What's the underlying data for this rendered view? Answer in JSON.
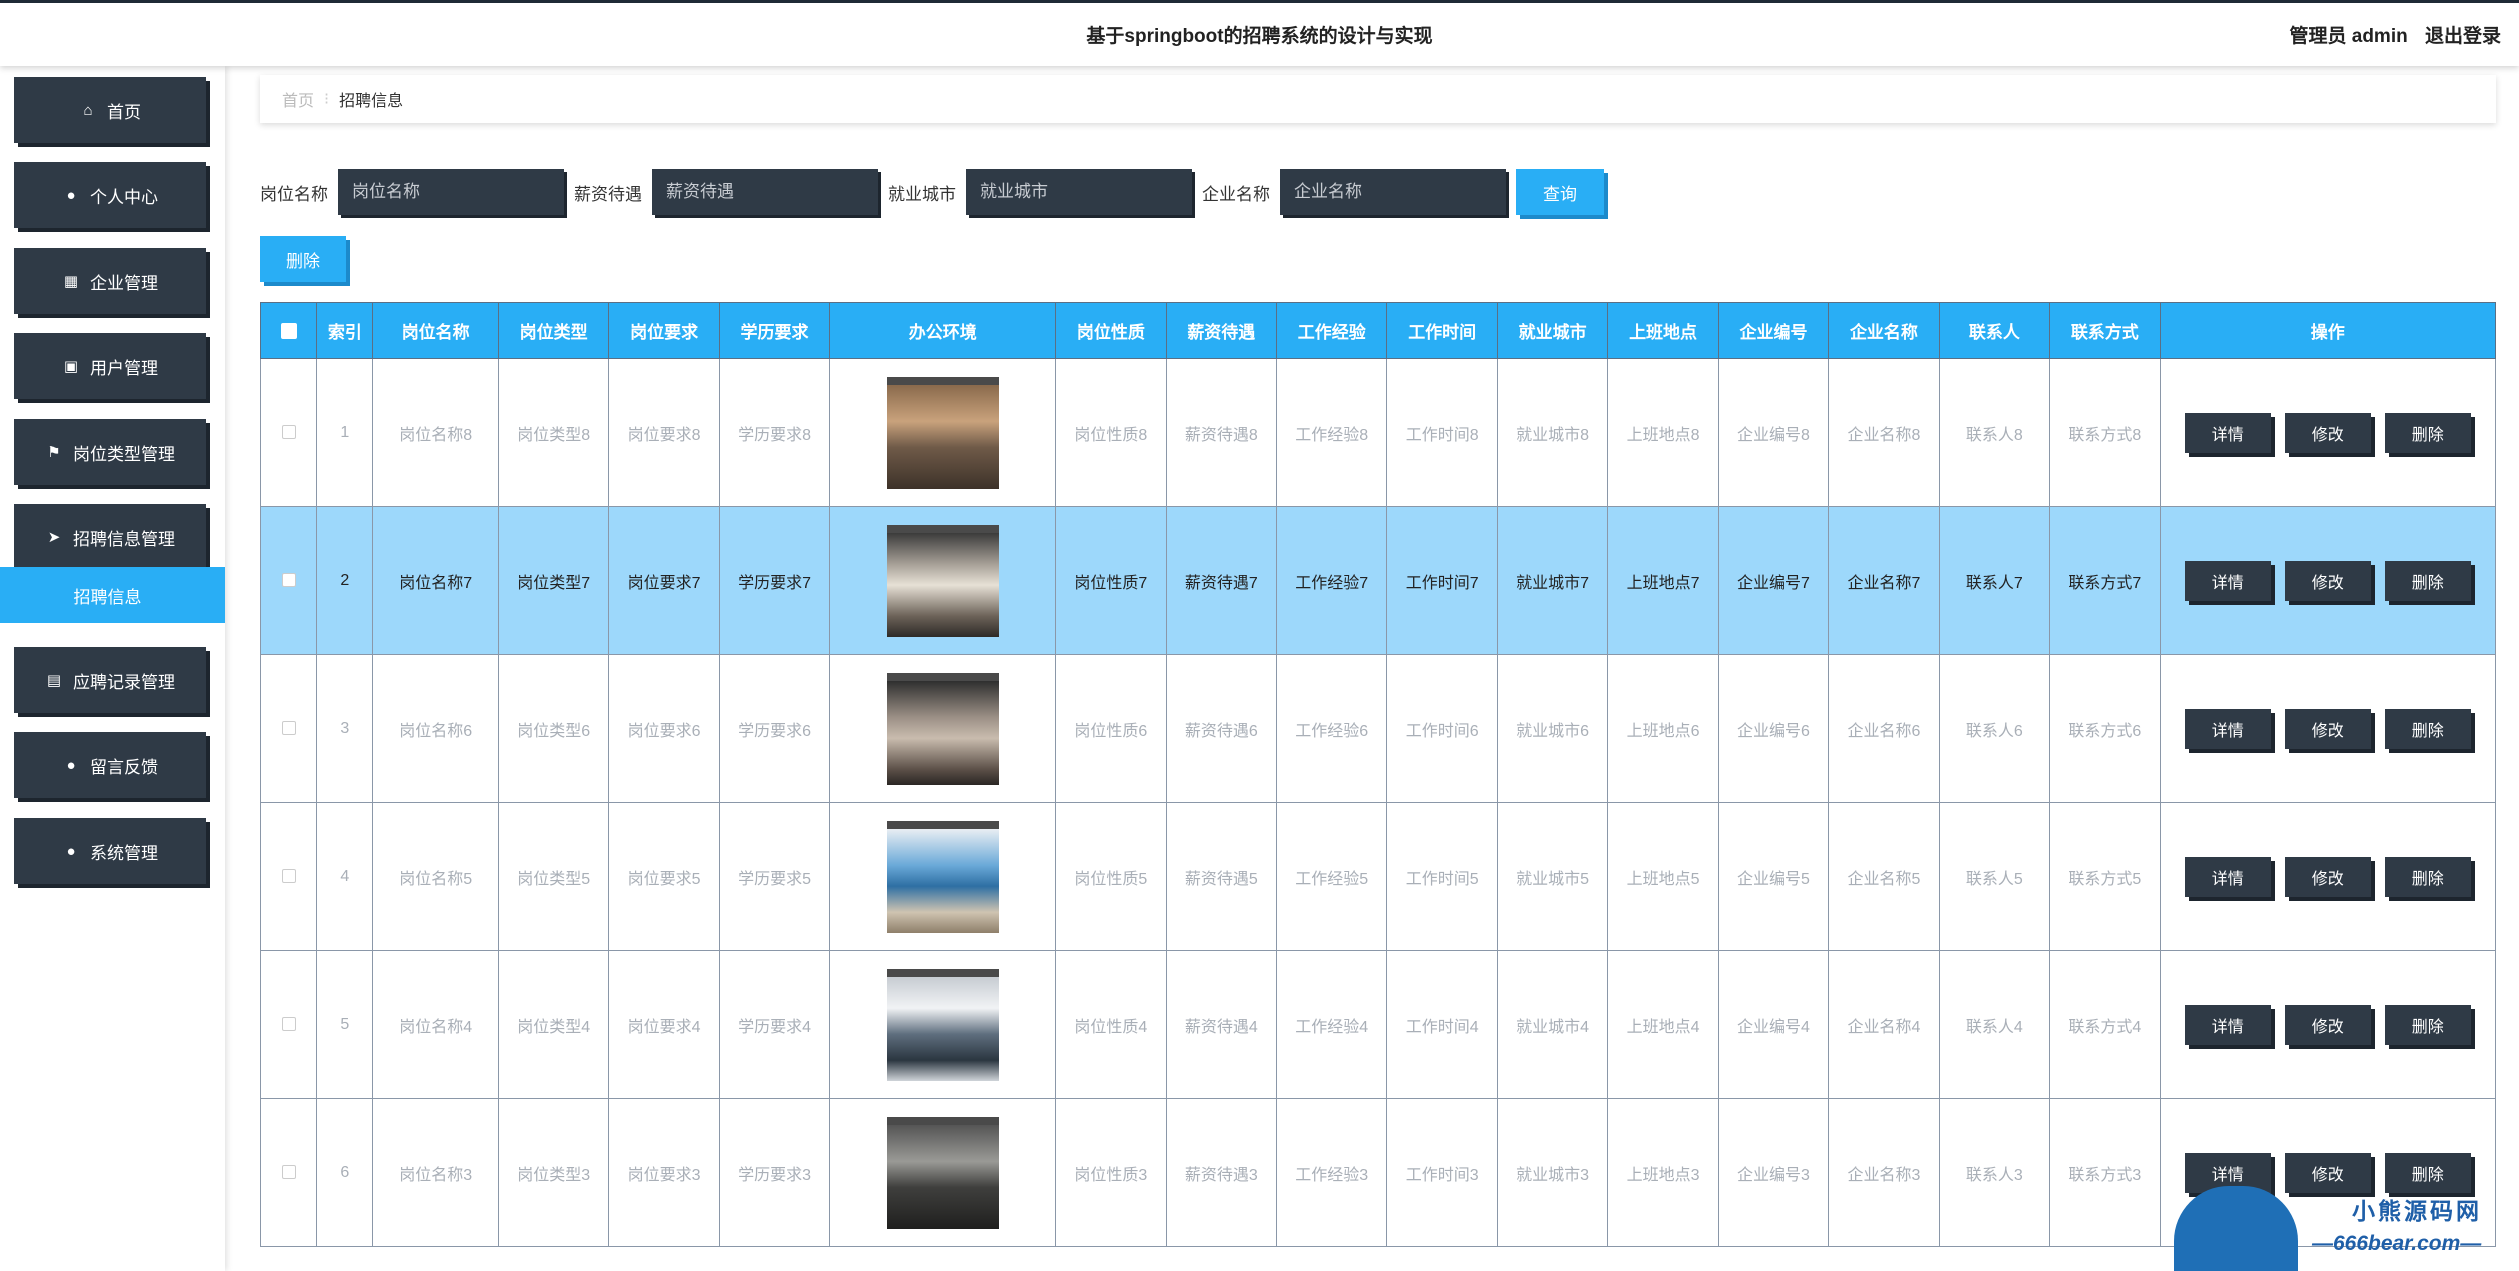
{
  "header": {
    "title": "基于springboot的招聘系统的设计与实现",
    "user_label": "管理员 admin",
    "logout_label": "退出登录"
  },
  "sidebar": {
    "items": [
      {
        "label": "首页",
        "icon": "home-icon"
      },
      {
        "label": "个人中心",
        "icon": "user-icon"
      },
      {
        "label": "企业管理",
        "icon": "grid-icon"
      },
      {
        "label": "用户管理",
        "icon": "clipboard-icon"
      },
      {
        "label": "岗位类型管理",
        "icon": "flag-icon"
      },
      {
        "label": "招聘信息管理",
        "icon": "paper-plane-icon"
      },
      {
        "label": "应聘记录管理",
        "icon": "printer-icon"
      },
      {
        "label": "留言反馈",
        "icon": "location-pin-icon"
      },
      {
        "label": "系统管理",
        "icon": "user-icon"
      }
    ],
    "active_sub": "招聘信息"
  },
  "breadcrumb": {
    "home": "首页",
    "current": "招聘信息"
  },
  "search": {
    "fields": [
      {
        "label": "岗位名称",
        "placeholder": "岗位名称"
      },
      {
        "label": "薪资待遇",
        "placeholder": "薪资待遇"
      },
      {
        "label": "就业城市",
        "placeholder": "就业城市"
      },
      {
        "label": "企业名称",
        "placeholder": "企业名称"
      }
    ],
    "query_label": "查询",
    "delete_label": "删除"
  },
  "table": {
    "columns": [
      "索引",
      "岗位名称",
      "岗位类型",
      "岗位要求",
      "学历要求",
      "办公环境",
      "岗位性质",
      "薪资待遇",
      "工作经验",
      "工作时间",
      "就业城市",
      "上班地点",
      "企业编号",
      "企业名称",
      "联系人",
      "联系方式",
      "操作"
    ],
    "rows": [
      {
        "index": "1",
        "cells": [
          "岗位名称8",
          "岗位类型8",
          "岗位要求8",
          "学历要求8",
          "岗位性质8",
          "薪资待遇8",
          "工作经验8",
          "工作时间8",
          "就业城市8",
          "上班地点8",
          "企业编号8",
          "企业名称8",
          "联系人8",
          "联系方式8"
        ]
      },
      {
        "index": "2",
        "cells": [
          "岗位名称7",
          "岗位类型7",
          "岗位要求7",
          "学历要求7",
          "岗位性质7",
          "薪资待遇7",
          "工作经验7",
          "工作时间7",
          "就业城市7",
          "上班地点7",
          "企业编号7",
          "企业名称7",
          "联系人7",
          "联系方式7"
        ]
      },
      {
        "index": "3",
        "cells": [
          "岗位名称6",
          "岗位类型6",
          "岗位要求6",
          "学历要求6",
          "岗位性质6",
          "薪资待遇6",
          "工作经验6",
          "工作时间6",
          "就业城市6",
          "上班地点6",
          "企业编号6",
          "企业名称6",
          "联系人6",
          "联系方式6"
        ]
      },
      {
        "index": "4",
        "cells": [
          "岗位名称5",
          "岗位类型5",
          "岗位要求5",
          "学历要求5",
          "岗位性质5",
          "薪资待遇5",
          "工作经验5",
          "工作时间5",
          "就业城市5",
          "上班地点5",
          "企业编号5",
          "企业名称5",
          "联系人5",
          "联系方式5"
        ]
      },
      {
        "index": "5",
        "cells": [
          "岗位名称4",
          "岗位类型4",
          "岗位要求4",
          "学历要求4",
          "岗位性质4",
          "薪资待遇4",
          "工作经验4",
          "工作时间4",
          "就业城市4",
          "上班地点4",
          "企业编号4",
          "企业名称4",
          "联系人4",
          "联系方式4"
        ]
      },
      {
        "index": "6",
        "cells": [
          "岗位名称3",
          "岗位类型3",
          "岗位要求3",
          "学历要求3",
          "岗位性质3",
          "薪资待遇3",
          "工作经验3",
          "工作时间3",
          "就业城市3",
          "上班地点3",
          "企业编号3",
          "企业名称3",
          "联系人3",
          "联系方式3"
        ]
      }
    ],
    "actions": {
      "detail": "详情",
      "edit": "修改",
      "delete": "删除"
    }
  },
  "watermark": {
    "line1": "小熊源码网",
    "line2": "—666bear.com—"
  },
  "colors": {
    "accent": "#29aef5",
    "dark": "#2f3a46",
    "selected_row": "#9dd8fb"
  }
}
